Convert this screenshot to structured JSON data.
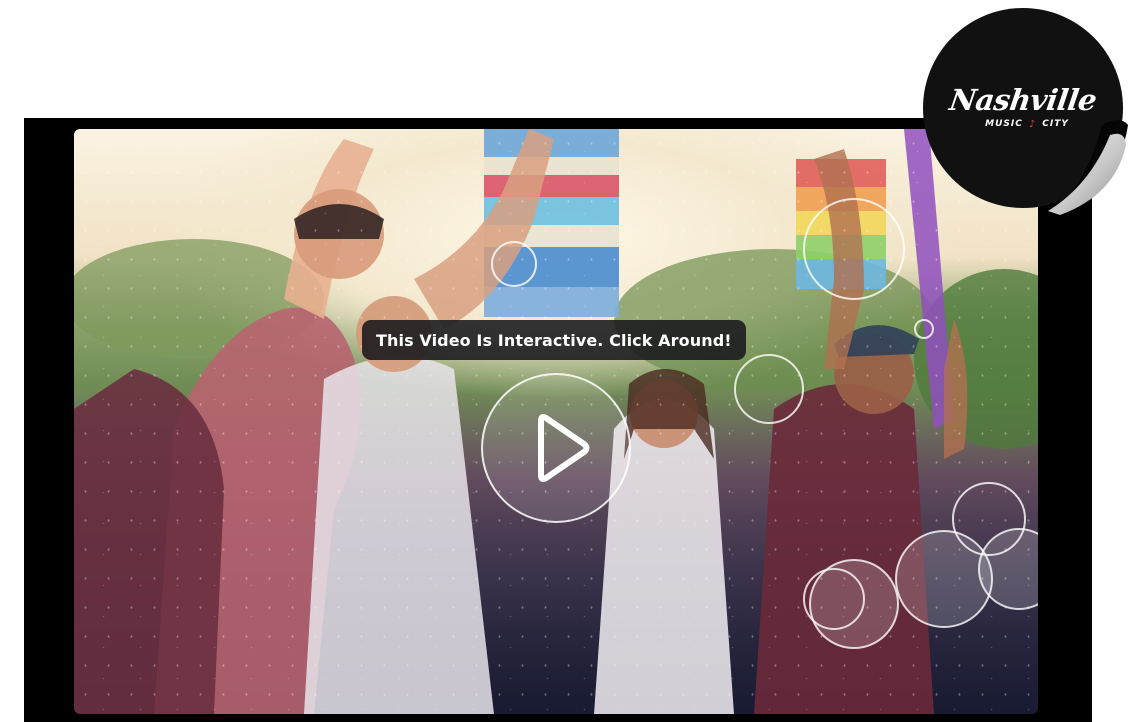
{
  "video": {
    "tooltip_text": "This Video Is Interactive. Click Around!",
    "play_button_label": "Play video"
  },
  "sticker": {
    "wordmark": "Nashville",
    "subline_left": "MUSIC",
    "subline_note": "♪",
    "subline_right": "CITY"
  },
  "colors": {
    "frame": "#000000",
    "tooltip_bg": "#18181c",
    "sticker_bg": "#111111",
    "accent_red": "#e04040"
  },
  "icons": [
    "play-icon",
    "music-note-icon"
  ]
}
